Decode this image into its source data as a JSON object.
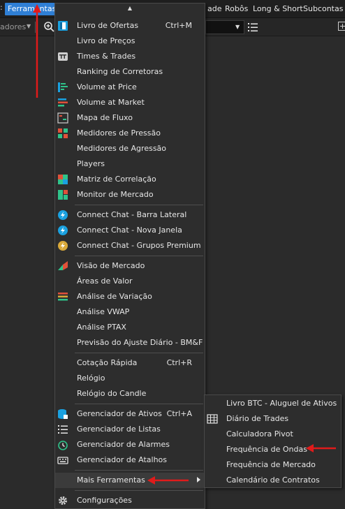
{
  "menubar": {
    "items": [
      "Ferramentas",
      "ade",
      "Robôs",
      "Long & Short",
      "Subcontas"
    ]
  },
  "toolbar": {
    "left_label": "adores"
  },
  "menu": {
    "groups": [
      [
        {
          "label": "Livro de Ofertas",
          "shortcut": "Ctrl+M",
          "icon": "order-book-icon"
        },
        {
          "label": "Livro de Preços",
          "shortcut": "",
          "icon": ""
        },
        {
          "label": "Times & Trades",
          "shortcut": "",
          "icon": "times-trades-icon"
        },
        {
          "label": "Ranking de Corretoras",
          "shortcut": "",
          "icon": ""
        },
        {
          "label": "Volume at Price",
          "shortcut": "",
          "icon": "volume-at-price-icon"
        },
        {
          "label": "Volume at Market",
          "shortcut": "",
          "icon": "volume-at-market-icon"
        },
        {
          "label": "Mapa de Fluxo",
          "shortcut": "",
          "icon": "flow-map-icon"
        },
        {
          "label": "Medidores de Pressão",
          "shortcut": "",
          "icon": "pressure-gauge-icon"
        },
        {
          "label": "Medidores de Agressão",
          "shortcut": "",
          "icon": ""
        },
        {
          "label": "Players",
          "shortcut": "",
          "icon": ""
        },
        {
          "label": "Matriz de Correlação",
          "shortcut": "",
          "icon": "correlation-matrix-icon"
        },
        {
          "label": "Monitor de Mercado",
          "shortcut": "",
          "icon": "market-monitor-icon"
        }
      ],
      [
        {
          "label": "Connect Chat - Barra Lateral",
          "shortcut": "",
          "icon": "chat-icon"
        },
        {
          "label": "Connect Chat - Nova Janela",
          "shortcut": "",
          "icon": "chat-icon"
        },
        {
          "label": "Connect Chat - Grupos Premium",
          "shortcut": "",
          "icon": "chat-premium-icon"
        }
      ],
      [
        {
          "label": "Visão de Mercado",
          "shortcut": "",
          "icon": "market-view-icon"
        },
        {
          "label": "Áreas de Valor",
          "shortcut": "",
          "icon": ""
        },
        {
          "label": "Análise de Variação",
          "shortcut": "",
          "icon": "variation-analysis-icon"
        },
        {
          "label": "Análise VWAP",
          "shortcut": "",
          "icon": ""
        },
        {
          "label": "Análise PTAX",
          "shortcut": "",
          "icon": ""
        },
        {
          "label": "Previsão do Ajuste Diário - BM&F",
          "shortcut": "",
          "icon": ""
        }
      ],
      [
        {
          "label": "Cotação Rápida",
          "shortcut": "Ctrl+R",
          "icon": ""
        },
        {
          "label": "Relógio",
          "shortcut": "",
          "icon": ""
        },
        {
          "label": "Relógio do Candle",
          "shortcut": "",
          "icon": ""
        }
      ],
      [
        {
          "label": "Gerenciador de Ativos",
          "shortcut": "Ctrl+A",
          "icon": "asset-manager-icon"
        },
        {
          "label": "Gerenciador de Listas",
          "shortcut": "",
          "icon": "list-manager-icon"
        },
        {
          "label": "Gerenciador de Alarmes",
          "shortcut": "",
          "icon": "alarm-icon"
        },
        {
          "label": "Gerenciador de Atalhos",
          "shortcut": "",
          "icon": "keyboard-icon"
        }
      ],
      [
        {
          "label": "Mais Ferramentas",
          "shortcut": "",
          "icon": "",
          "submenu": true
        }
      ],
      [
        {
          "label": "Configurações",
          "shortcut": "",
          "icon": "gear-icon"
        }
      ]
    ]
  },
  "submenu": {
    "items": [
      {
        "label": "Livro BTC - Aluguel de Ativos",
        "icon": ""
      },
      {
        "label": "Diário de Trades",
        "icon": "trade-journal-icon"
      },
      {
        "label": "Calculadora Pivot",
        "icon": ""
      },
      {
        "label": "Frequência de Ondas",
        "icon": ""
      },
      {
        "label": "Frequência de Mercado",
        "icon": ""
      },
      {
        "label": "Calendário de Contratos",
        "icon": ""
      }
    ]
  },
  "colors": {
    "accent": "#2f7fd5",
    "arrow": "#e01b1b",
    "background": "#2b2b2b",
    "menu_bg": "#2d2d2d"
  }
}
